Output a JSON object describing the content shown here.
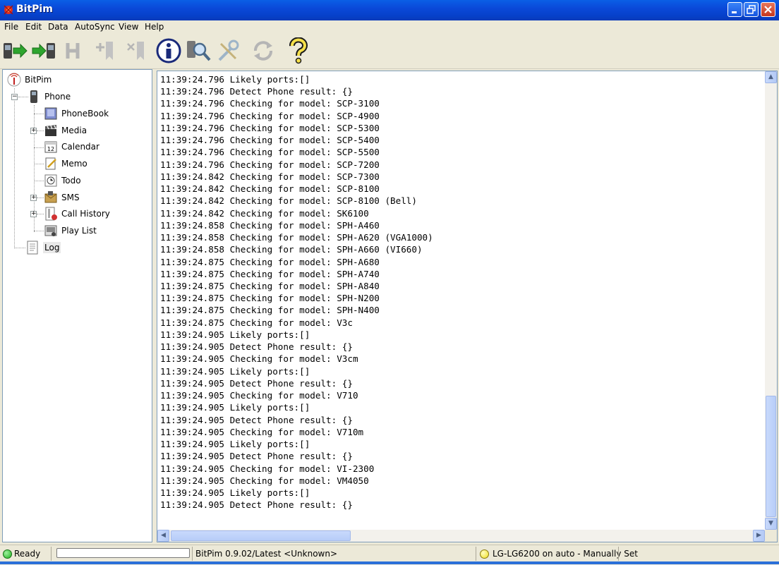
{
  "window": {
    "title": "BitPim"
  },
  "menu": [
    "File",
    "Edit",
    "Data",
    "AutoSync",
    "View",
    "Help"
  ],
  "toolbar": [
    "get-phone-data-icon",
    "send-phone-data-icon",
    "history-icon",
    "add-entry-icon",
    "delete-entry-icon",
    "info-icon",
    "find-phone-icon",
    "settings-icon",
    "refresh-icon",
    "help-icon"
  ],
  "tree": {
    "root": "BitPim",
    "phone": "Phone",
    "items": [
      "PhoneBook",
      "Media",
      "Calendar",
      "Memo",
      "Todo",
      "SMS",
      "Call History",
      "Play List"
    ],
    "log": "Log"
  },
  "log_lines": [
    "11:39:24.796 Likely ports:[]",
    "11:39:24.796 Detect Phone result: {}",
    "11:39:24.796 Checking for model: SCP-3100",
    "11:39:24.796 Checking for model: SCP-4900",
    "11:39:24.796 Checking for model: SCP-5300",
    "11:39:24.796 Checking for model: SCP-5400",
    "11:39:24.796 Checking for model: SCP-5500",
    "11:39:24.796 Checking for model: SCP-7200",
    "11:39:24.842 Checking for model: SCP-7300",
    "11:39:24.842 Checking for model: SCP-8100",
    "11:39:24.842 Checking for model: SCP-8100 (Bell)",
    "11:39:24.842 Checking for model: SK6100",
    "11:39:24.858 Checking for model: SPH-A460",
    "11:39:24.858 Checking for model: SPH-A620 (VGA1000)",
    "11:39:24.858 Checking for model: SPH-A660 (VI660)",
    "11:39:24.875 Checking for model: SPH-A680",
    "11:39:24.875 Checking for model: SPH-A740",
    "11:39:24.875 Checking for model: SPH-A840",
    "11:39:24.875 Checking for model: SPH-N200",
    "11:39:24.875 Checking for model: SPH-N400",
    "11:39:24.875 Checking for model: V3c",
    "11:39:24.905 Likely ports:[]",
    "11:39:24.905 Detect Phone result: {}",
    "11:39:24.905 Checking for model: V3cm",
    "11:39:24.905 Likely ports:[]",
    "11:39:24.905 Detect Phone result: {}",
    "11:39:24.905 Checking for model: V710",
    "11:39:24.905 Likely ports:[]",
    "11:39:24.905 Detect Phone result: {}",
    "11:39:24.905 Checking for model: V710m",
    "11:39:24.905 Likely ports:[]",
    "11:39:24.905 Detect Phone result: {}",
    "11:39:24.905 Checking for model: VI-2300",
    "11:39:24.905 Checking for model: VM4050",
    "11:39:24.905 Likely ports:[]",
    "11:39:24.905 Detect Phone result: {}"
  ],
  "status": {
    "ready": "Ready",
    "version": "BitPim 0.9.02/Latest <Unknown>",
    "phone": "LG-LG6200 on auto - Manually Set",
    "ready_color": "#1fb31f",
    "phone_color": "#f0e020"
  }
}
